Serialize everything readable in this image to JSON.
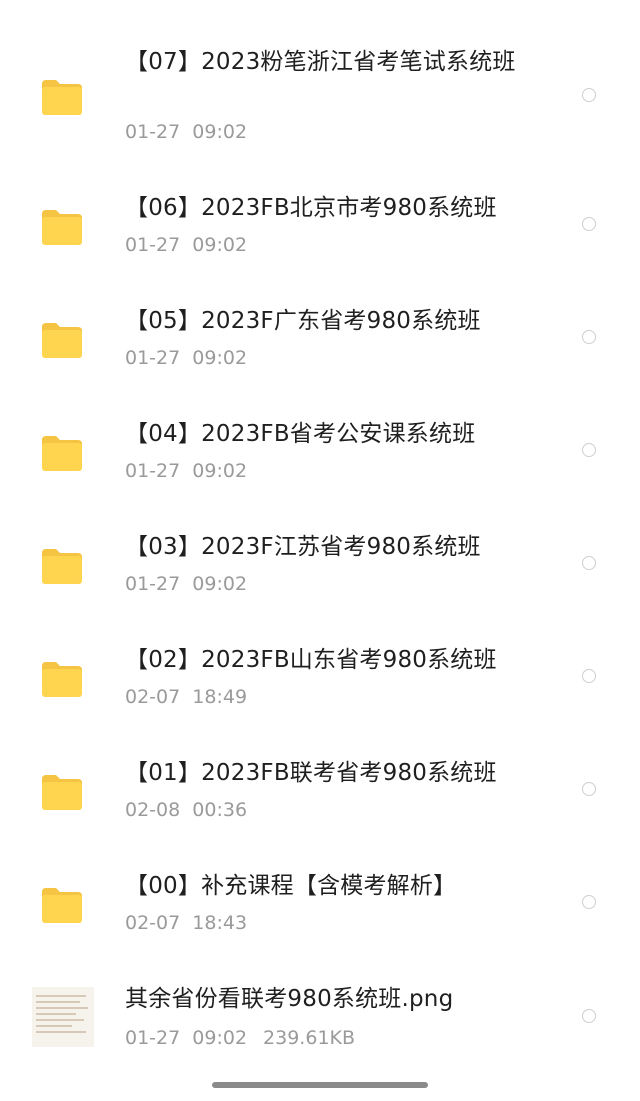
{
  "files": [
    {
      "name": "【07】2023粉笔浙江省考笔试系统班",
      "date": "01-27  09:02",
      "type": "folder",
      "icon": "folder-icon"
    },
    {
      "name": "【06】2023FB北京市考980系统班",
      "date": "01-27  09:02",
      "type": "folder",
      "icon": "folder-icon"
    },
    {
      "name": "【05】2023F广东省考980系统班",
      "date": "01-27  09:02",
      "type": "folder",
      "icon": "folder-icon"
    },
    {
      "name": "【04】2023FB省考公安课系统班",
      "date": "01-27  09:02",
      "type": "folder",
      "icon": "folder-icon"
    },
    {
      "name": "【03】2023F江苏省考980系统班",
      "date": "01-27  09:02",
      "type": "folder",
      "icon": "folder-icon"
    },
    {
      "name": "【02】2023FB山东省考980系统班",
      "date": "02-07  18:49",
      "type": "folder",
      "icon": "folder-icon"
    },
    {
      "name": "【01】2023FB联考省考980系统班",
      "date": "02-08  00:36",
      "type": "folder",
      "icon": "folder-icon"
    },
    {
      "name": "【00】补充课程【含模考解析】",
      "date": "02-07  18:43",
      "type": "folder",
      "icon": "folder-icon"
    },
    {
      "name": "其余省份看联考980系统班.png",
      "date": "01-27  09:02",
      "size": "239.61KB",
      "type": "image",
      "icon": "image-thumbnail"
    }
  ],
  "colors": {
    "folder": "#FFD54F",
    "folder_tab": "#F6C443",
    "text_primary": "#1f1f1f",
    "text_secondary": "#9a9a9a",
    "radio_border": "#cfcfcf"
  }
}
